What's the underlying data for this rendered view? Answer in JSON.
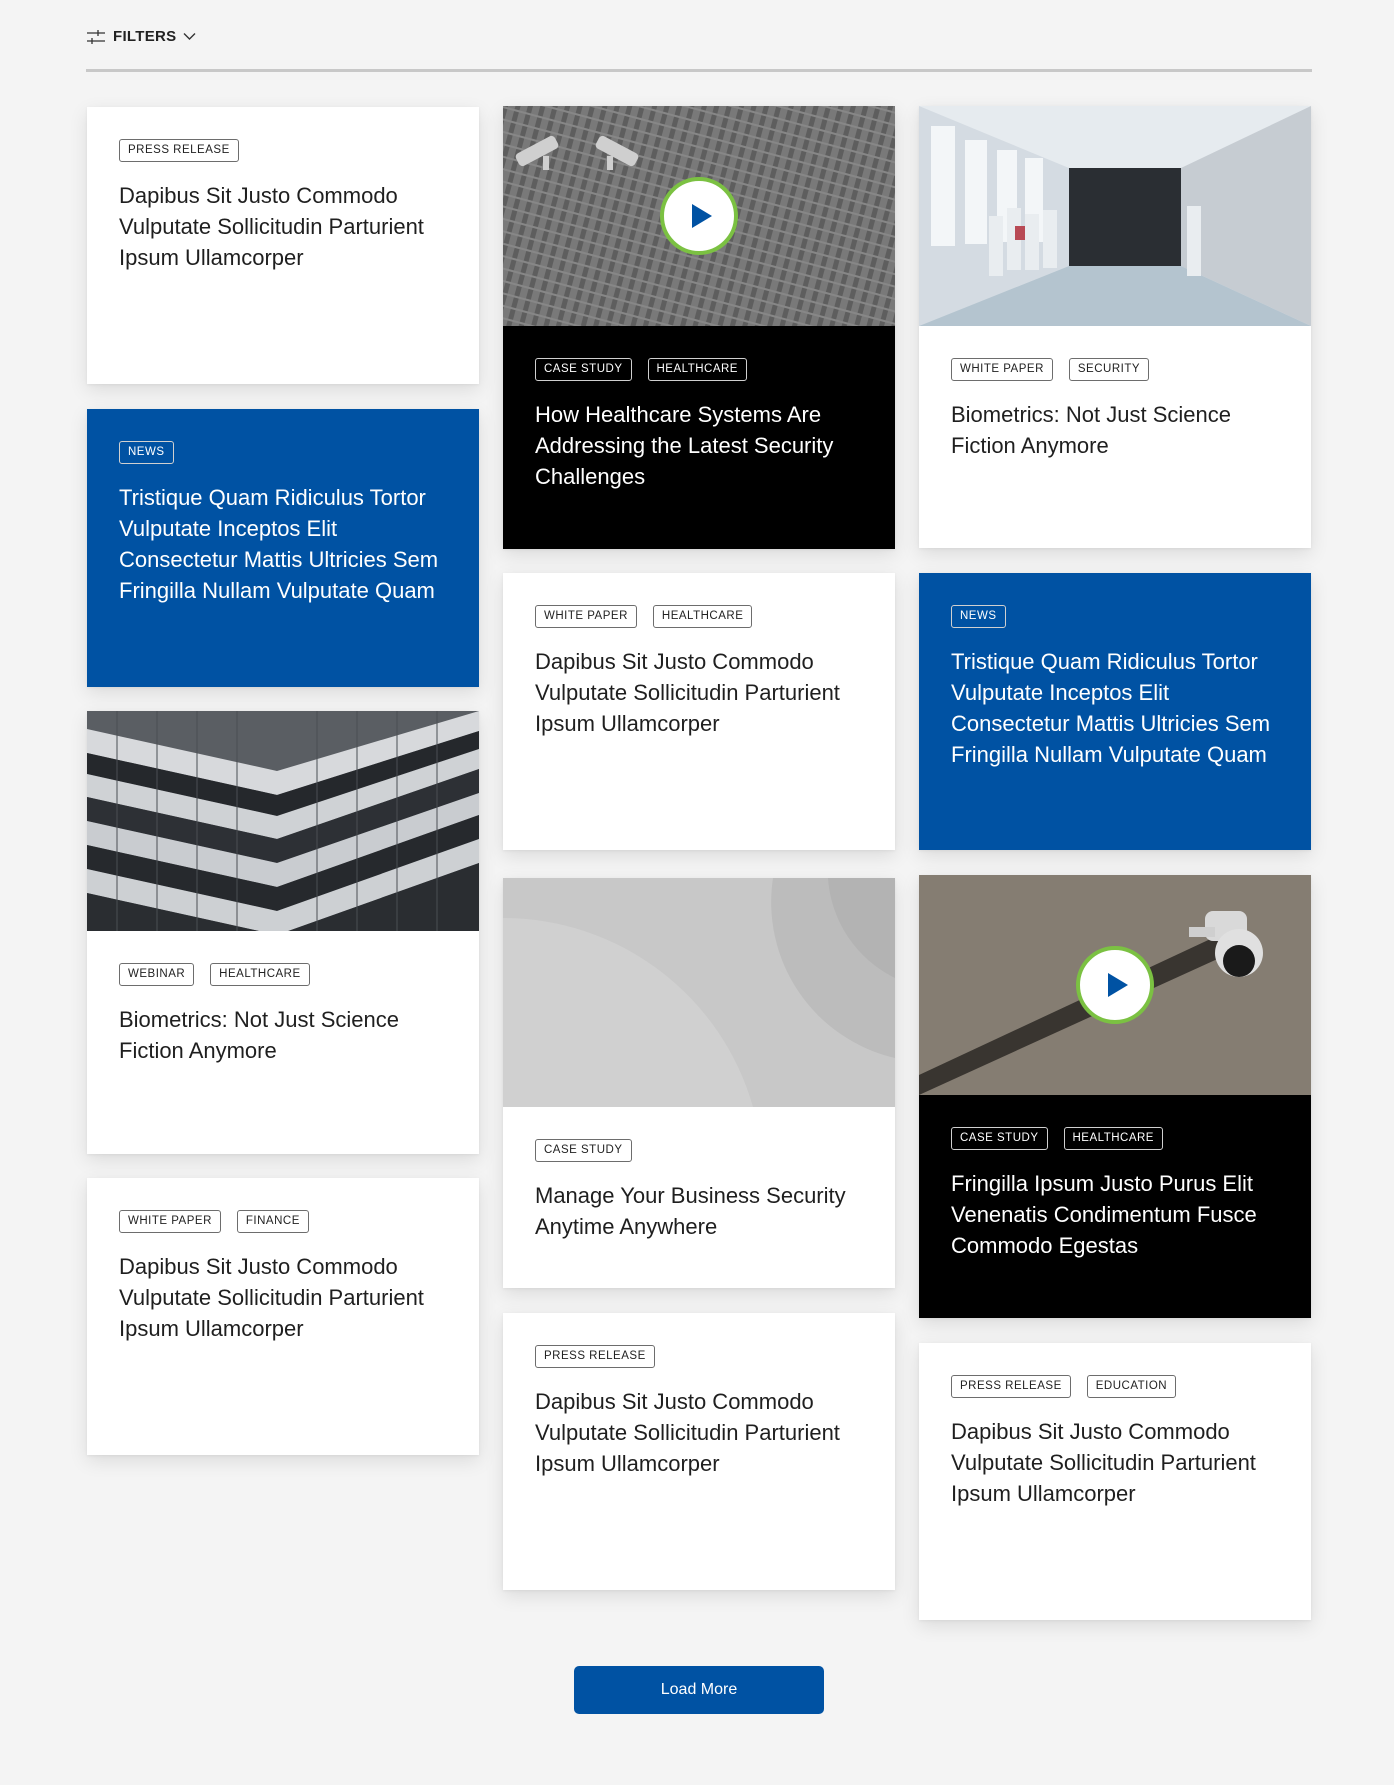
{
  "filters": {
    "label": "FILTERS",
    "icon": "sliders-icon",
    "chevron": "chevron-down-icon"
  },
  "colors": {
    "accent": "#0052a3",
    "play_ring": "#7bc142",
    "dark_card": "#000000",
    "background": "#f4f4f4"
  },
  "cards": [
    {
      "tags": [
        "PRESS RELEASE"
      ],
      "title": "Dapibus Sit Justo Commodo Vulputate Sollicitudin Parturient Ipsum Ullamcorper"
    },
    {
      "tags": [
        "NEWS"
      ],
      "title": "Tristique Quam Ridiculus Tortor Vulputate Inceptos Elit Consectetur Mattis Ultricies Sem Fringilla Nullam Vulputate Quam"
    },
    {
      "tags": [
        "WEBINAR",
        "HEALTHCARE"
      ],
      "title": "Biometrics: Not Just Science Fiction Anymore",
      "image": "office-building-photo"
    },
    {
      "tags": [
        "WHITE PAPER",
        "FINANCE"
      ],
      "title": "Dapibus Sit Justo Commodo Vulputate Sollicitudin Parturient Ipsum Ullamcorper"
    },
    {
      "tags": [
        "CASE STUDY",
        "HEALTHCARE"
      ],
      "title": "How Healthcare Systems Are Addressing the Latest Security Challenges",
      "image": "security-cameras-wall-photo",
      "video": true
    },
    {
      "tags": [
        "WHITE PAPER",
        "HEALTHCARE"
      ],
      "title": "Dapibus Sit Justo Commodo Vulputate Sollicitudin Parturient Ipsum Ullamcorper"
    },
    {
      "tags": [
        "CASE STUDY"
      ],
      "title": "Manage Your Business Security Anytime Anywhere",
      "image": "gray-placeholder-graphic"
    },
    {
      "tags": [
        "PRESS RELEASE"
      ],
      "title": "Dapibus Sit Justo Commodo Vulputate Sollicitudin Parturient Ipsum Ullamcorper"
    },
    {
      "tags": [
        "WHITE PAPER",
        "SECURITY"
      ],
      "title": "Biometrics: Not Just Science Fiction Anymore",
      "image": "hospital-corridor-photo"
    },
    {
      "tags": [
        "NEWS"
      ],
      "title": "Tristique Quam Ridiculus Tortor Vulputate Inceptos Elit Consectetur Mattis Ultricies Sem Fringilla Nullam Vulputate Quam"
    },
    {
      "tags": [
        "CASE STUDY",
        "HEALTHCARE"
      ],
      "title": "Fringilla Ipsum Justo Purus Elit Venenatis Condimentum Fusce Commodo Egestas",
      "image": "dome-camera-photo",
      "video": true
    },
    {
      "tags": [
        "PRESS RELEASE",
        "EDUCATION"
      ],
      "title": "Dapibus Sit Justo Commodo Vulputate Sollicitudin Parturient Ipsum Ullamcorper"
    }
  ],
  "load_more": {
    "label": "Load More"
  }
}
